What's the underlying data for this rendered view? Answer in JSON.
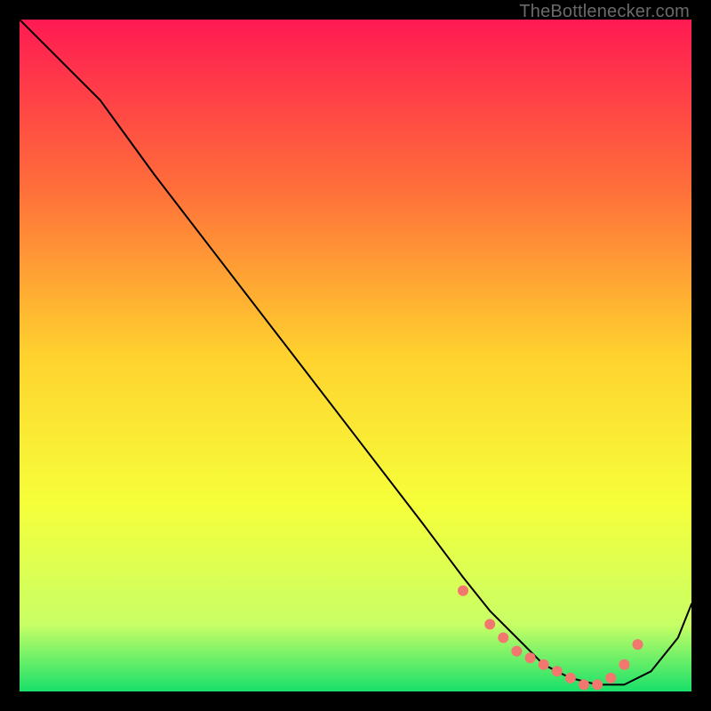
{
  "watermark": "TheBottlenecker.com",
  "chart_data": {
    "type": "line",
    "title": "",
    "xlabel": "",
    "ylabel": "",
    "xlim": [
      0,
      100
    ],
    "ylim": [
      0,
      100
    ],
    "background_gradient": {
      "stops": [
        {
          "offset": 0,
          "color": "#ff1a52"
        },
        {
          "offset": 25,
          "color": "#ff6e3a"
        },
        {
          "offset": 50,
          "color": "#ffd22e"
        },
        {
          "offset": 72,
          "color": "#f6ff3a"
        },
        {
          "offset": 90,
          "color": "#c8ff66"
        },
        {
          "offset": 100,
          "color": "#18e06a"
        }
      ]
    },
    "series": [
      {
        "name": "bottleneck-curve",
        "color": "#000000",
        "stroke_width": 2,
        "x": [
          0,
          7,
          12,
          20,
          30,
          40,
          50,
          60,
          66,
          70,
          74,
          78,
          82,
          86,
          90,
          94,
          98,
          100
        ],
        "y": [
          100,
          93,
          88,
          77,
          64,
          51,
          38,
          25,
          17,
          12,
          8,
          4,
          2,
          1,
          1,
          3,
          8,
          13
        ]
      }
    ],
    "markers": {
      "name": "optimal-range-dots",
      "color": "#f2776e",
      "radius": 6,
      "x": [
        66,
        70,
        72,
        74,
        76,
        78,
        80,
        82,
        84,
        86,
        88,
        90,
        92
      ],
      "y": [
        15,
        10,
        8,
        6,
        5,
        4,
        3,
        2,
        1,
        1,
        2,
        4,
        7
      ]
    }
  }
}
